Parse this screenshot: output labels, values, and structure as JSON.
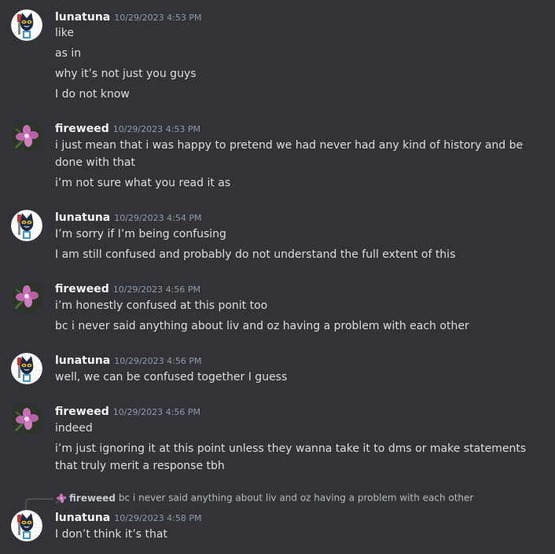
{
  "messages": [
    {
      "author": "lunatuna",
      "timestamp": "10/29/2023 4:53 PM",
      "avatar": "cat-avatar",
      "lines": [
        "like",
        "as in",
        "why it’s not just you guys",
        "I do not know"
      ]
    },
    {
      "author": "fireweed",
      "timestamp": "10/29/2023 4:53 PM",
      "avatar": "flower-avatar",
      "lines": [
        "i just mean that i was happy to pretend we had never had any kind of history and be done with that",
        "i’m not sure what you read it as"
      ]
    },
    {
      "author": "lunatuna",
      "timestamp": "10/29/2023 4:54 PM",
      "avatar": "cat-avatar",
      "lines": [
        "I’m sorry if I’m being confusing",
        "I am still confused and probably do not understand the full extent of this"
      ]
    },
    {
      "author": "fireweed",
      "timestamp": "10/29/2023 4:56 PM",
      "avatar": "flower-avatar",
      "lines": [
        "i’m honestly confused at this ponit too",
        "bc i never said anything about liv and oz having a problem with each other"
      ]
    },
    {
      "author": "lunatuna",
      "timestamp": "10/29/2023 4:56 PM",
      "avatar": "cat-avatar",
      "lines": [
        "well, we can be confused together I guess"
      ]
    },
    {
      "author": "fireweed",
      "timestamp": "10/29/2023 4:56 PM",
      "avatar": "flower-avatar",
      "lines": [
        "indeed",
        "i’m just ignoring it at this point unless they wanna take it to dms or make statements that truly merit a response tbh"
      ]
    },
    {
      "author": "lunatuna",
      "timestamp": "10/29/2023 4:58 PM",
      "avatar": "cat-avatar",
      "lines": [
        "I don’t think it’s that"
      ]
    }
  ],
  "reply": {
    "author": "fireweed",
    "text": "bc i never said anything about liv and oz having a problem with each other",
    "icon": "flower-avatar"
  },
  "colors": {
    "background": "#313338",
    "author": "#f2f3f5",
    "timestamp": "#949ba4",
    "text": "#dbdee1"
  }
}
